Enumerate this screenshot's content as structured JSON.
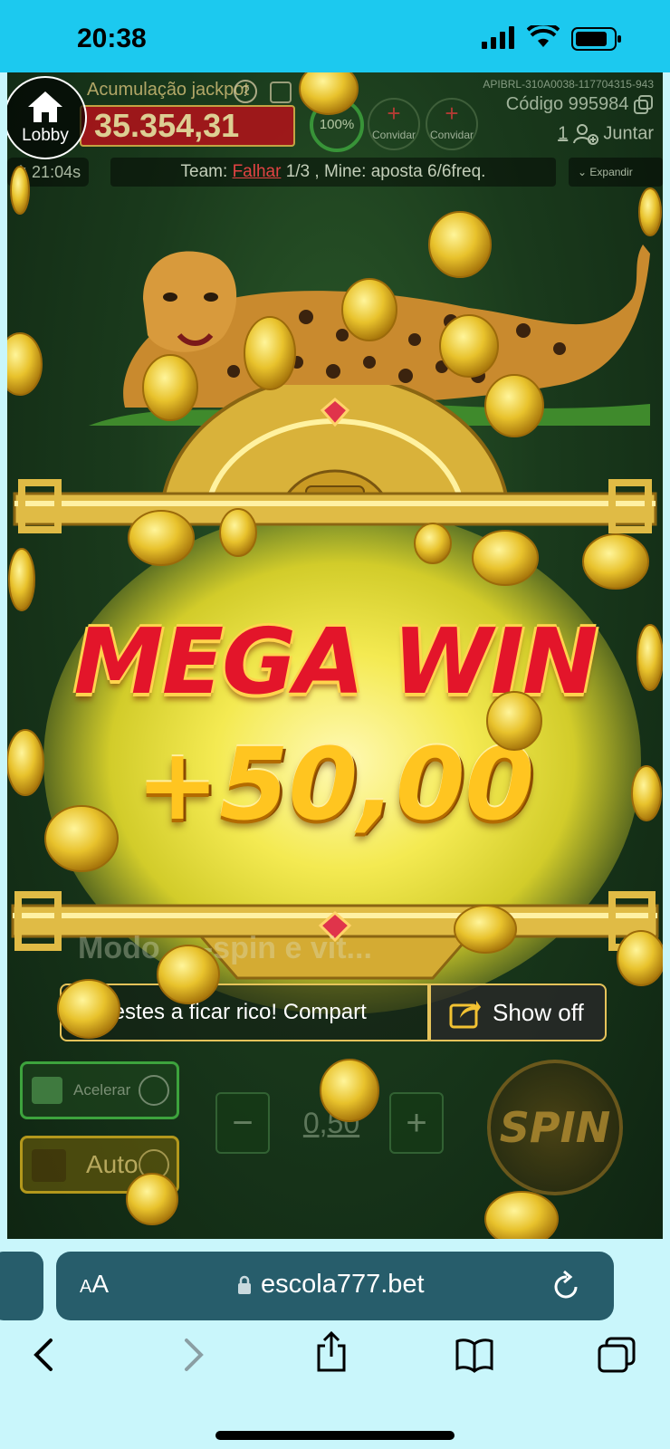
{
  "status_bar": {
    "time": "20:38"
  },
  "game": {
    "lobby_label": "Lobby",
    "jackpot_title": "Acumulação jackpot",
    "jackpot_value": "35.354,31",
    "progress_label": "100%",
    "invite_labels": [
      "Convidar",
      "Convidar"
    ],
    "api_id": "APIBRL-310A0038-117704315-943",
    "code_text": "Código 995984",
    "join_text": "Juntar",
    "join_count": "1",
    "timer": "21:04s",
    "team_prefix": "Team:",
    "team_fail": "Falhar",
    "team_suffix": "1/3 , Mine: aposta 6/6freq.",
    "expand_label": "Expandir",
    "win_title": "MEGA WIN",
    "win_amount": "+50,00",
    "mode_text": "Modo ... -spin e vit...",
    "share_text": "estes a ficar rico! Compart",
    "show_off_label": "Show off",
    "accelerate_label": "Acelerar",
    "auto_label": "Auto",
    "bet_value": "0,50",
    "spin_label": "SPIN"
  },
  "browser": {
    "aa_label": "AA",
    "url": "escola777.bet"
  },
  "colors": {
    "status_bar": "#1cc9ef",
    "browser_bg": "#c9f6fb",
    "url_bar": "#275d6b",
    "mega_win_red": "#e3152a",
    "amount_gold": "#ffc520",
    "frame_gold": "#e6c35a"
  },
  "icons": [
    "signal-icon",
    "wifi-icon",
    "battery-icon",
    "home-icon",
    "help-icon",
    "list-icon",
    "copy-icon",
    "add-user-icon",
    "chevron-down-icon",
    "thumbs-up-icon",
    "share-icon",
    "check-icon",
    "lightning-icon",
    "play-icon",
    "lock-icon",
    "reload-icon",
    "back-icon",
    "forward-icon",
    "share-sheet-icon",
    "bookmarks-icon",
    "tabs-icon"
  ]
}
